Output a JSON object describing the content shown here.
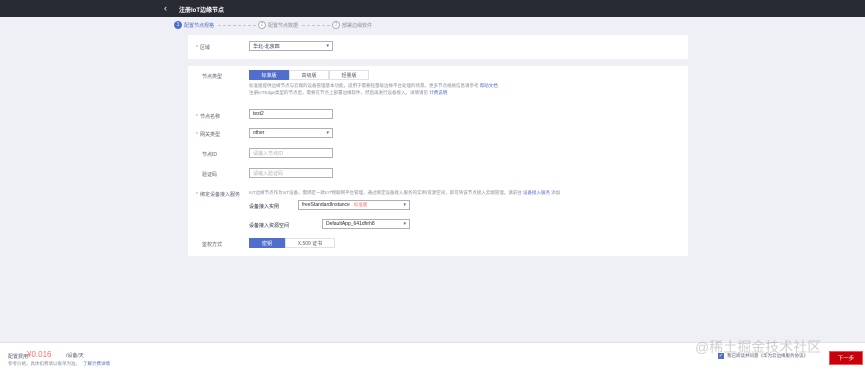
{
  "header": {
    "back_icon": "chevron-left-icon",
    "title": "注册IoT边缘节点"
  },
  "steps": [
    {
      "num": "1",
      "label": "配置节点规格"
    },
    {
      "num": "2",
      "label": "配置节点数据"
    },
    {
      "num": "3",
      "label": "部署边缘软件"
    }
  ],
  "region": {
    "label": "区域",
    "value": "华北-北京四"
  },
  "node_type": {
    "label": "节点类型",
    "options": [
      "标准版",
      "高级版",
      "轻量版"
    ],
    "selected": "标准版",
    "desc_line1": "标准版提供边缘节点与云端的设备管理基本功能，适用于需要轻量级边缘平台处理的场景。更多节点规格信息请参考",
    "desc_link1": "帮助文档",
    "desc_line2": "注册IoTEdge类型的节点后，需要在节点上部署边缘软件，然后再进行设备接入。详情请见",
    "desc_link2": "计费说明"
  },
  "node_name": {
    "label": "节点名称",
    "value": "test2"
  },
  "gateway_type": {
    "label": "网关类型",
    "value": "other"
  },
  "node_id": {
    "label": "节点ID",
    "placeholder": "请输入节点ID"
  },
  "verify_code": {
    "label": "验证码",
    "placeholder": "请输入验证码"
  },
  "access_service": {
    "label": "绑定设备接入服务",
    "desc": "IoT边缘节点作为IoT设备，需绑定一款IoT物联网平台管理，通过绑定设备接入服务的实例/资源空间，即可将该节点接入云端管理。请前往",
    "desc_link": "设备接入服务",
    "desc_tail": "添加",
    "instance_label": "设备接入实例",
    "instance_value": "freeStandardInstance",
    "instance_tag": "标准版",
    "space_label": "设备接入资源空间",
    "space_value": "DefaultApp_641dhrh8"
  },
  "auth": {
    "label": "鉴权方式",
    "options": [
      "密钥",
      "X.509 证书"
    ],
    "selected": "密钥"
  },
  "footer": {
    "fee_label": "配置费用:",
    "fee_value": "¥0.016",
    "fee_unit": "/设备/天",
    "fee_note": "参考价格，具体扣费请以账单为准。",
    "fee_link": "了解计费详情",
    "agree_text": "我已阅读并同意《华为云边缘服务协议》",
    "next_label": "下一步"
  },
  "watermark": "@稀土掘金技术社区"
}
